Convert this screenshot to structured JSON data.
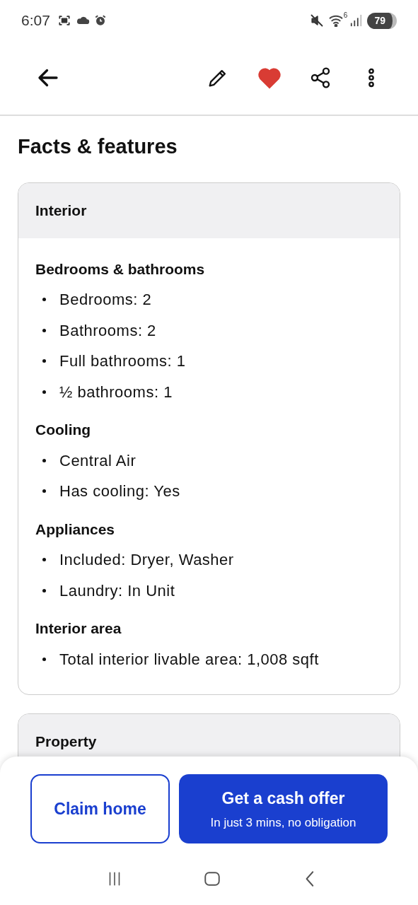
{
  "status_bar": {
    "time": "6:07",
    "battery": "79",
    "wifi_badge": "6"
  },
  "header": {
    "favorited": true
  },
  "title": "Facts & features",
  "cards": [
    {
      "heading": "Interior",
      "groups": [
        {
          "heading": "Bedrooms & bathrooms",
          "items": [
            "Bedrooms: 2",
            "Bathrooms: 2",
            "Full bathrooms: 1",
            "½ bathrooms: 1"
          ]
        },
        {
          "heading": "Cooling",
          "items": [
            "Central Air",
            "Has cooling: Yes"
          ]
        },
        {
          "heading": "Appliances",
          "items": [
            "Included: Dryer, Washer",
            "Laundry: In Unit"
          ]
        },
        {
          "heading": "Interior area",
          "items": [
            "Total interior livable area: 1,008 sqft"
          ]
        }
      ]
    },
    {
      "heading": "Property"
    }
  ],
  "actions": {
    "secondary": "Claim home",
    "primary": "Get a cash offer",
    "primary_sub": "In just 3 mins, no obligation"
  }
}
